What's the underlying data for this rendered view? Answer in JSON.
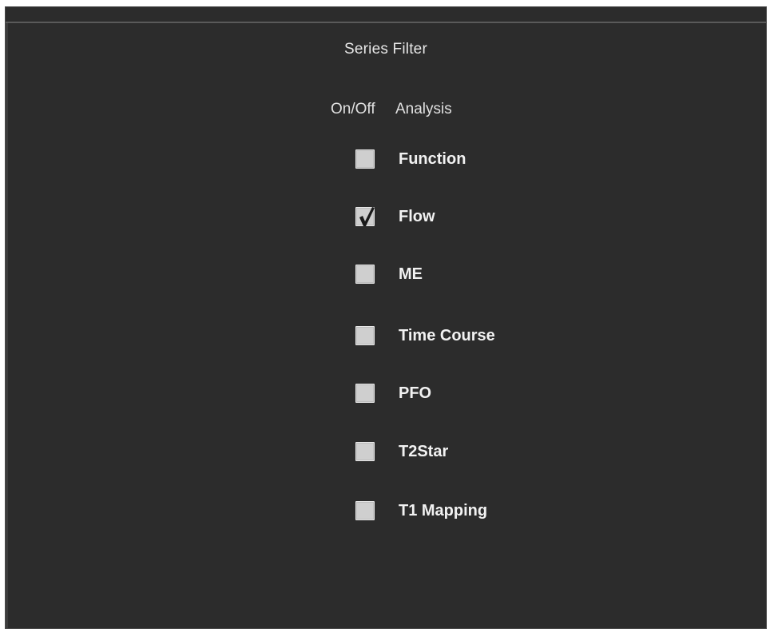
{
  "panel": {
    "title": "Series Filter",
    "columns": {
      "on_off": "On/Off",
      "analysis": "Analysis"
    },
    "items": [
      {
        "label": "Function",
        "checked": false
      },
      {
        "label": "Flow",
        "checked": true
      },
      {
        "label": "ME",
        "checked": false
      },
      {
        "label": "Time Course",
        "checked": false
      },
      {
        "label": "PFO",
        "checked": false
      },
      {
        "label": "T2Star",
        "checked": false
      },
      {
        "label": "T1 Mapping",
        "checked": false
      }
    ]
  },
  "colors": {
    "panel_background": "#2c2c2c",
    "text": "#f2f2f2",
    "checkbox": "#cfcfcf",
    "checkmark": "#1a1a1a"
  },
  "icons": {
    "checked": "checkmark-icon"
  }
}
